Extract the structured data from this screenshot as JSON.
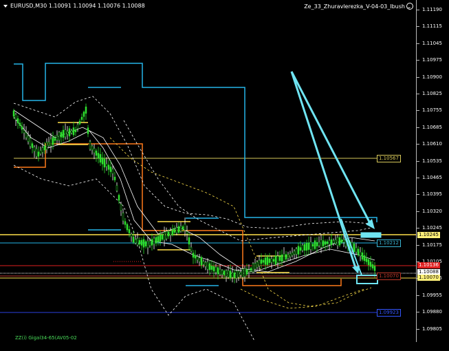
{
  "window": {
    "symbol_line": "EURUSD,M30  1.10091 1.10094 1.10076 1.10088",
    "indicator_name": "Ze_33_Zhuravlerezka_V-04-03_Ibush"
  },
  "footer_text": "ZZ(i) Gigal34-65(AV05-02",
  "axis": {
    "ticks": [
      "1.11190",
      "1.11115",
      "1.11045",
      "1.10975",
      "1.10900",
      "1.10825",
      "1.10755",
      "1.10685",
      "1.10610",
      "1.10535",
      "1.10465",
      "1.10395",
      "1.10320",
      "1.10245",
      "1.10175",
      "1.10105",
      "1.10035",
      "1.09955",
      "1.09880",
      "1.09805"
    ]
  },
  "price_tags": [
    {
      "text": "1.10245",
      "bg": "#fff17a",
      "fg": "#000"
    },
    {
      "text": "1.10136",
      "bg": "#e02020",
      "fg": "#fff"
    },
    {
      "text": "1.10088",
      "bg": "#ffffff",
      "fg": "#000"
    },
    {
      "text": "1.10070",
      "bg": "#fff17a",
      "fg": "#000"
    }
  ],
  "level_labels": [
    {
      "text": "1.10567",
      "color": "#d8c95a"
    },
    {
      "text": "1.10212",
      "color": "#3ab7d6"
    },
    {
      "text": "1.10070",
      "color": "#c0392b"
    },
    {
      "text": "1.09923",
      "color": "#3355ff"
    }
  ],
  "colors": {
    "bull_candle": "#2fe02f",
    "bear_candle": "#ffffff",
    "cyan_line": "#25b6e9",
    "orange_line": "#ff7a1a",
    "yellow_line": "#ffe14a",
    "red_line": "#e02020",
    "blue_line": "#2c3fe0",
    "arrow": "#6fe4f2"
  }
}
